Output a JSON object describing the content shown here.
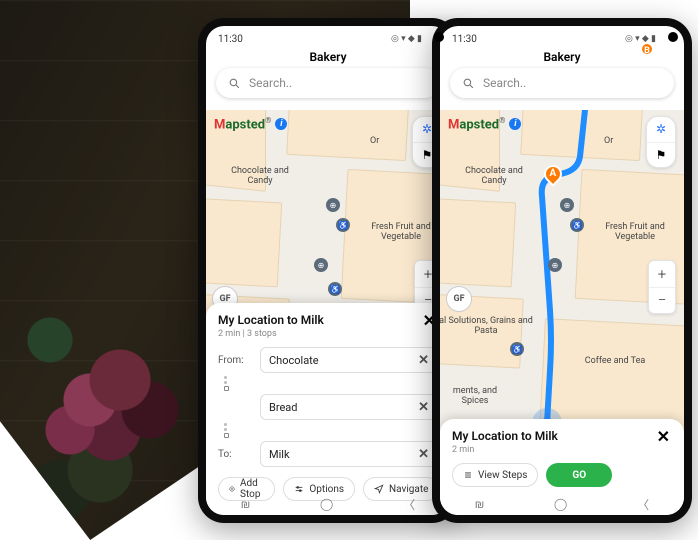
{
  "status": {
    "time": "11:30"
  },
  "header": {
    "title": "Bakery"
  },
  "search": {
    "placeholder": "Search.."
  },
  "brand": {
    "first": "M",
    "rest": "apsted",
    "reg": "®",
    "info": "i"
  },
  "map_labels": {
    "organic_top": "Or",
    "choc_candy": "Chocolate and Candy",
    "fresh_fruit": "Fresh Fruit and Vegetable",
    "al_solutions": "al Solutions, Grains and Pasta",
    "coffee_tea": "Coffee and Tea",
    "ments_spices": "ments, and Spices",
    "gf": "GF"
  },
  "zoom": {
    "in": "+",
    "out": "−"
  },
  "route_marker": {
    "a": "A",
    "b": "B"
  },
  "phone1": {
    "sheet_title": "My Location to Milk",
    "sheet_meta": "2 min | 3 stops",
    "from_label": "From:",
    "to_label": "To:",
    "stop1": "Chocolate",
    "stop2": "Bread",
    "stop3": "Milk",
    "add_stop": "Add Stop",
    "options": "Options",
    "navigate": "Navigate"
  },
  "phone2": {
    "sheet_title": "My Location to Milk",
    "sheet_meta": "2 min",
    "view_steps": "View Steps",
    "go": "GO"
  },
  "icons": {
    "accessibility": "♿",
    "star": "✦",
    "dot": "•"
  }
}
